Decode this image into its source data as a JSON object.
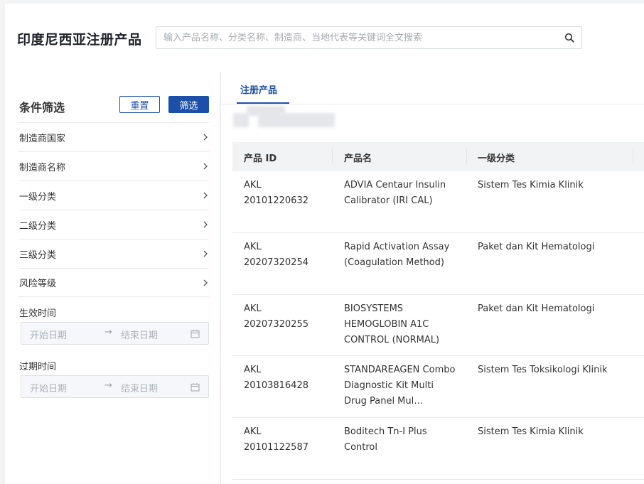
{
  "header": {
    "title": "印度尼西亚注册产品",
    "search_placeholder": "输入产品名称、分类名称、制造商、当地代表等关键词全文搜索"
  },
  "sidebar": {
    "title": "条件筛选",
    "reset_label": "重置",
    "filter_label": "筛选",
    "items": [
      {
        "label": "制造商国家"
      },
      {
        "label": "制造商名称"
      },
      {
        "label": "一级分类"
      },
      {
        "label": "二级分类"
      },
      {
        "label": "三级分类"
      },
      {
        "label": "风险等级"
      }
    ],
    "effective_label": "生效时间",
    "expiry_label": "过期时间",
    "start_placeholder": "开始日期",
    "end_placeholder": "结束日期",
    "range_arrow": "→"
  },
  "main": {
    "tab_label": "注册产品",
    "columns": [
      "产品 ID",
      "产品名",
      "一级分类"
    ],
    "rows": [
      {
        "id_line1": "AKL",
        "id_line2": "20101220632",
        "name": "ADVIA Centaur Insulin Calibrator (IRI CAL)",
        "category": "Sistem Tes Kimia Klinik"
      },
      {
        "id_line1": "AKL",
        "id_line2": "20207320254",
        "name": "Rapid Activation Assay (Coagulation Method)",
        "category": "Paket dan Kit Hematologi"
      },
      {
        "id_line1": "AKL",
        "id_line2": "20207320255",
        "name": "BIOSYSTEMS HEMOGLOBIN A1C CONTROL (NORMAL)",
        "category": "Paket dan Kit Hematologi"
      },
      {
        "id_line1": "AKL",
        "id_line2": "20103816428",
        "name": "STANDAREAGEN Combo Diagnostic Kit Multi Drug Panel Mul…",
        "category": "Sistem Tes Toksikologi Klinik"
      },
      {
        "id_line1": "AKL",
        "id_line2": "20101122587",
        "name": "Boditech Tn-I Plus Control",
        "category": "Sistem Tes Kimia Klinik"
      }
    ]
  },
  "colors": {
    "accent": "#1c4fa8",
    "background": "#f2f3f5"
  }
}
